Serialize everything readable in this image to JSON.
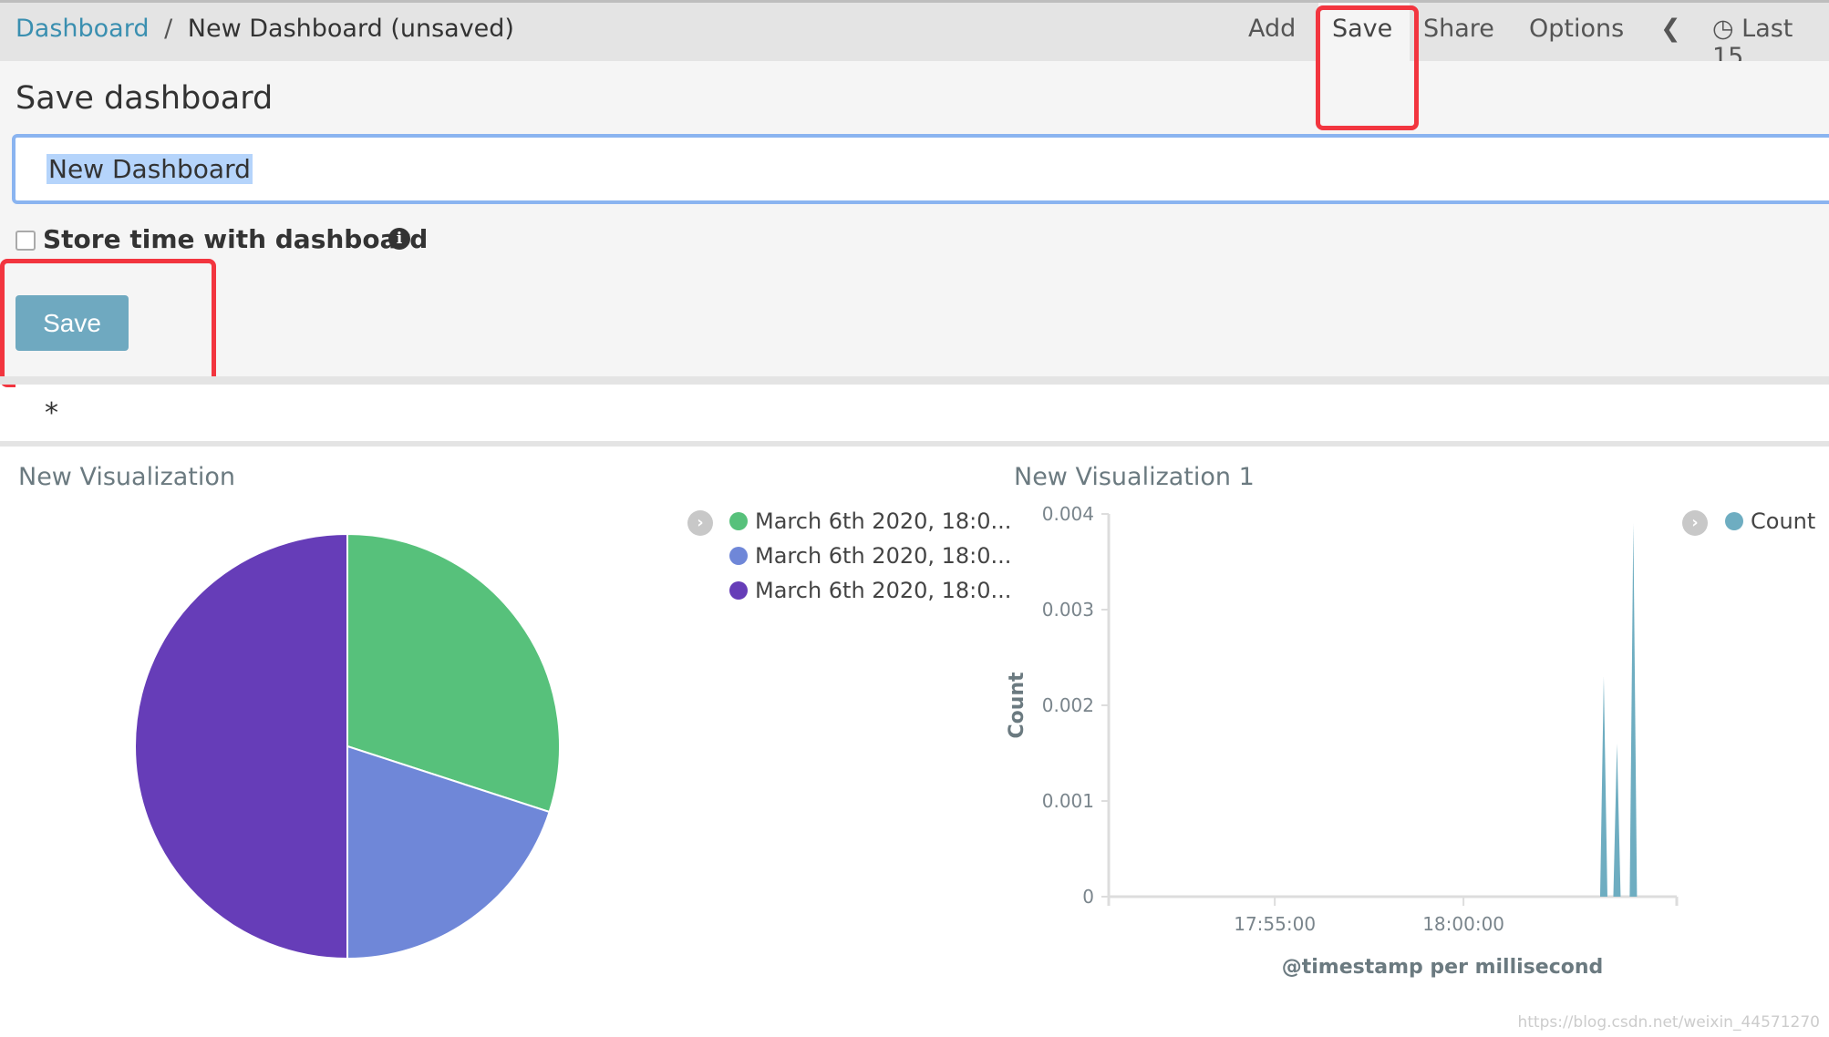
{
  "breadcrumb": {
    "root": "Dashboard",
    "separator": "/",
    "current": "New Dashboard (unsaved)"
  },
  "topnav": {
    "add": "Add",
    "save": "Save",
    "share": "Share",
    "options": "Options",
    "time": "Last 15"
  },
  "save_panel": {
    "title": "Save dashboard",
    "name_value": "New Dashboard",
    "store_time_label": "Store time with dashboard",
    "store_time_checked": false,
    "save_button": "Save"
  },
  "query": {
    "value": "*"
  },
  "panels": {
    "pie": {
      "title": "New Visualization",
      "legend": [
        "March 6th 2020, 18:0...",
        "March 6th 2020, 18:0...",
        "March 6th 2020, 18:0..."
      ]
    },
    "line": {
      "title": "New Visualization 1",
      "legend": "Count"
    }
  },
  "chart_data": [
    {
      "type": "pie",
      "slices": [
        {
          "label": "March 6th 2020, 18:0...",
          "value": 30,
          "color": "#57c17b"
        },
        {
          "label": "March 6th 2020, 18:0...",
          "value": 20,
          "color": "#6f87d8"
        },
        {
          "label": "March 6th 2020, 18:0...",
          "value": 50,
          "color": "#663db8"
        }
      ]
    },
    {
      "type": "area",
      "xlabel": "@timestamp per millisecond",
      "ylabel": "Count",
      "ylim": [
        0,
        0.004
      ],
      "yticks": [
        "0",
        "0.001",
        "0.002",
        "0.003",
        "0.004"
      ],
      "xticks": [
        "17:55:00",
        "18:00:00"
      ],
      "xlim": [
        "17:50:36",
        "18:05:39"
      ],
      "color": "#6eadc1",
      "points": [
        {
          "x": "18:03:43",
          "y": 0.0023
        },
        {
          "x": "18:04:04",
          "y": 0.0016
        },
        {
          "x": "18:04:30",
          "y": 0.0039
        }
      ]
    }
  ],
  "watermark": "https://blog.csdn.net/weixin_44571270"
}
